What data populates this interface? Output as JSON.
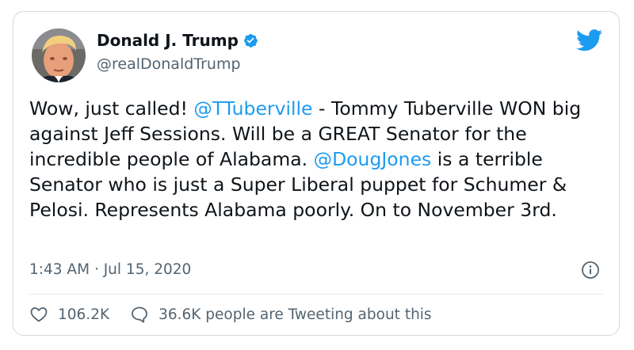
{
  "author": {
    "display_name": "Donald J. Trump",
    "handle": "@realDonaldTrump",
    "verified": true
  },
  "icons": {
    "avatar": "profile-photo",
    "verified": "verified-badge-icon",
    "brand": "twitter-bird-icon",
    "info": "info-icon",
    "like": "heart-icon",
    "reply": "speech-bubble-icon"
  },
  "tweet": {
    "segments": [
      {
        "text": "Wow, just called! "
      },
      {
        "text": "@TTuberville",
        "mention": true
      },
      {
        "text": " - Tommy Tuberville WON big against Jeff Sessions. Will be a GREAT Senator for the incredible people of Alabama. "
      },
      {
        "text": "@DougJones",
        "mention": true
      },
      {
        "text": " is a terrible Senator who is just a Super Liberal puppet for Schumer & Pelosi. Represents Alabama poorly. On to November 3rd."
      }
    ]
  },
  "meta": {
    "time": "1:43 AM",
    "separator": "·",
    "date": "Jul 15, 2020"
  },
  "stats": {
    "likes": "106.2K",
    "tweeting_text": "36.6K people are Tweeting about this"
  },
  "colors": {
    "accent": "#1d9bf0",
    "text": "#0f1419",
    "muted": "#536471",
    "border": "#cfd9de"
  }
}
